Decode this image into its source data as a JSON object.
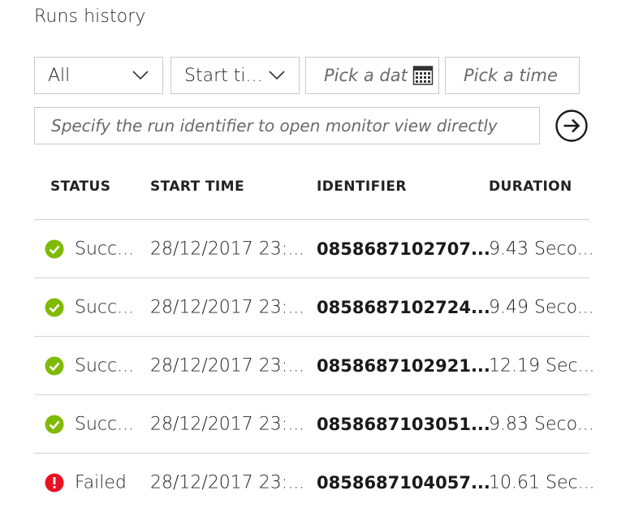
{
  "page": {
    "title": "Runs history"
  },
  "filters": {
    "status_value": "All",
    "start_time_value": "Start ti...",
    "date_placeholder": "Pick a dat",
    "time_placeholder": "Pick a time",
    "run_id_placeholder": "Specify the run identifier to open monitor view directly"
  },
  "table": {
    "headers": {
      "status": "STATUS",
      "start_time": "START TIME",
      "identifier": "IDENTIFIER",
      "duration": "DURATION"
    },
    "rows": [
      {
        "status": "Succ...",
        "status_type": "success",
        "start": "28/12/2017 23:...",
        "id": "0858687102707...",
        "duration": "9.43 Seco..."
      },
      {
        "status": "Succ...",
        "status_type": "success",
        "start": "28/12/2017 23:...",
        "id": "0858687102724...",
        "duration": "9.49 Seco..."
      },
      {
        "status": "Succ...",
        "status_type": "success",
        "start": "28/12/2017 23:...",
        "id": "0858687102921...",
        "duration": "12.19 Sec..."
      },
      {
        "status": "Succ...",
        "status_type": "success",
        "start": "28/12/2017 23:...",
        "id": "0858687103051...",
        "duration": "9.83 Seco..."
      },
      {
        "status": "Failed",
        "status_type": "failed",
        "start": "28/12/2017 23:...",
        "id": "0858687104057...",
        "duration": "10.61 Sec..."
      }
    ]
  },
  "colors": {
    "success": "#7fba00",
    "failed": "#e81123"
  },
  "icons": {
    "success": "check-circle-icon",
    "failed": "error-circle-icon",
    "dropdown": "chevron-down-icon",
    "calendar": "calendar-icon",
    "go": "arrow-right-circle-icon"
  }
}
